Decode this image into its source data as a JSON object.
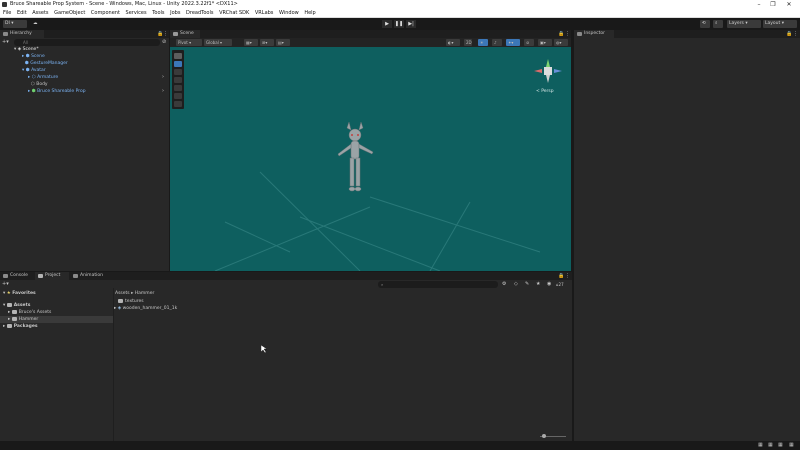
{
  "window": {
    "title": "Bruce Shareable Prop System - Scene - Windows, Mac, Linux - Unity 2022.3.22f1* <DX11>",
    "controls": [
      "–",
      "❐",
      "✕"
    ]
  },
  "menu": [
    "File",
    "Edit",
    "Assets",
    "GameObject",
    "Component",
    "Services",
    "Tools",
    "Jobs",
    "DreadTools",
    "VRChat SDK",
    "VRLabs",
    "Window",
    "Help"
  ],
  "toolbar": {
    "account": "DI",
    "layers": "Layers",
    "layout": "Layout"
  },
  "hierarchy": {
    "tab": "Hierarchy",
    "search_placeholder": "All",
    "items": [
      {
        "label": "Scene*",
        "depth": 0
      },
      {
        "label": "Scene",
        "depth": 1
      },
      {
        "label": "GestureManager",
        "depth": 1
      },
      {
        "label": "Avatar",
        "depth": 1
      },
      {
        "label": "Armature",
        "depth": 2
      },
      {
        "label": "Body",
        "depth": 2
      },
      {
        "label": "Bruce Shareable Prop",
        "depth": 2
      }
    ]
  },
  "scene": {
    "tab": "Scene",
    "pivot": "Pivot",
    "global": "Global",
    "persp": "< Persp"
  },
  "inspector": {
    "tab": "Inspector"
  },
  "bottom": {
    "tabs": [
      "Console",
      "Project",
      "Animation"
    ],
    "breadcrumb": [
      "Assets",
      "Hammer"
    ],
    "favorites": "Favorites",
    "tree": [
      "Assets",
      "Bruce's Assets",
      "Hammer",
      "Packages"
    ],
    "files": [
      "textures",
      "wooden_hammer_01_1k"
    ],
    "count": "27"
  }
}
